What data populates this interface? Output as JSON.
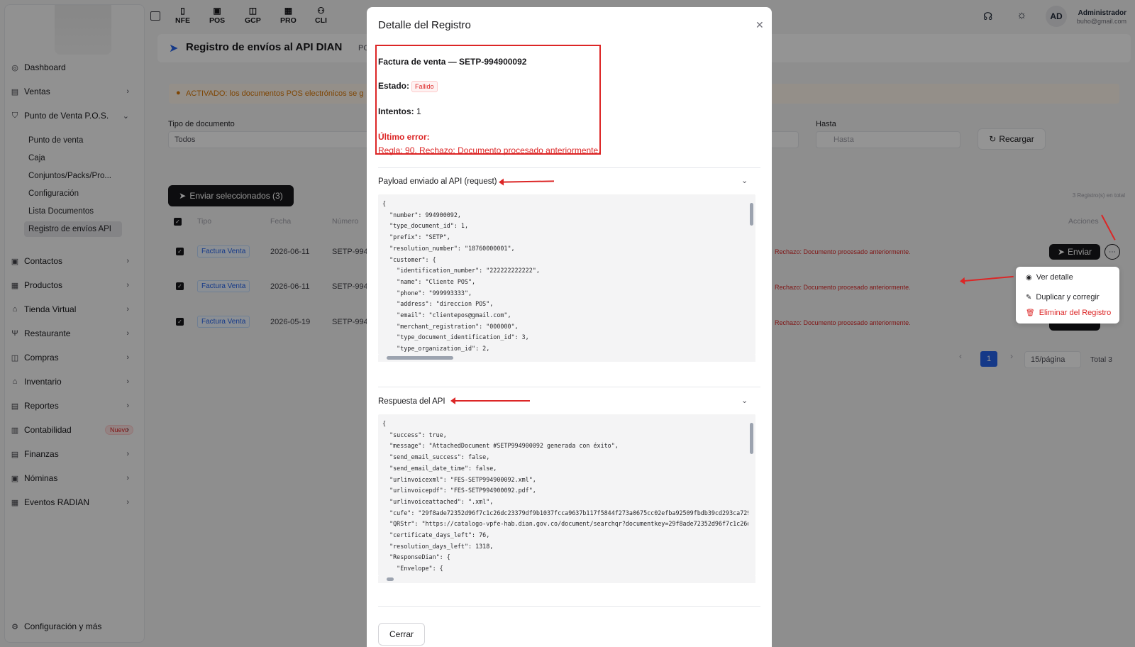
{
  "topbar": {
    "buttons": [
      {
        "label": "NFE",
        "icon": "file-icon"
      },
      {
        "label": "POS",
        "icon": "pos-icon"
      },
      {
        "label": "GCP",
        "icon": "bag-icon"
      },
      {
        "label": "PRO",
        "icon": "grid-icon"
      },
      {
        "label": "CLI",
        "icon": "users-icon"
      }
    ],
    "avatar_initials": "AD",
    "user_name": "Administrador",
    "user_email": "buho@gmail.com"
  },
  "sidebar": {
    "items": [
      {
        "label": "Dashboard",
        "icon": "dashboard-icon"
      },
      {
        "label": "Ventas",
        "icon": "receipt-icon"
      },
      {
        "label": "Punto de Venta P.O.S.",
        "icon": "cart-icon"
      },
      {
        "label": "Contactos",
        "icon": "contacts-icon"
      },
      {
        "label": "Productos",
        "icon": "grid-icon"
      },
      {
        "label": "Tienda Virtual",
        "icon": "store-icon"
      },
      {
        "label": "Restaurante",
        "icon": "restaurant-icon"
      },
      {
        "label": "Compras",
        "icon": "bag-icon"
      },
      {
        "label": "Inventario",
        "icon": "warehouse-icon"
      },
      {
        "label": "Reportes",
        "icon": "report-icon"
      },
      {
        "label": "Contabilidad",
        "icon": "calculator-icon",
        "badge": "Nuevo"
      },
      {
        "label": "Finanzas",
        "icon": "finance-icon"
      },
      {
        "label": "Nóminas",
        "icon": "payroll-icon"
      },
      {
        "label": "Eventos RADIAN",
        "icon": "calendar-icon"
      }
    ],
    "pos_subitems": [
      "Punto de venta",
      "Caja",
      "Conjuntos/Packs/Pro...",
      "Configuración",
      "Lista Documentos",
      "Registro de envíos API"
    ],
    "footer": "Configuración y más"
  },
  "page": {
    "title": "Registro de envíos al API DIAN",
    "title_suffix": "PO",
    "alert": "ACTIVADO: los documentos POS electrónicos se g",
    "filter_doc_label": "Tipo de documento",
    "filter_doc_value": "Todos",
    "filter_hasta_label": "Hasta",
    "filter_hasta_placeholder": "Hasta",
    "reload_button": "Recargar",
    "send_selected_button": "Enviar seleccionados (3)",
    "total_records": "3 Registro(s) en total",
    "columns": {
      "tipo": "Tipo",
      "fecha": "Fecha",
      "numero": "Número",
      "acciones": "Acciones"
    },
    "rows": [
      {
        "tipo": "Factura Venta",
        "fecha": "2026-06-11",
        "numero": "SETP-994",
        "error": "Rechazo: Documento procesado anteriormente."
      },
      {
        "tipo": "Factura Venta",
        "fecha": "2026-06-11",
        "numero": "SETP-994",
        "error": "Rechazo: Documento procesado anteriormente."
      },
      {
        "tipo": "Factura Venta",
        "fecha": "2026-05-19",
        "numero": "SETP-994",
        "error": "Rechazo: Documento procesado anteriormente."
      }
    ],
    "send_button": "Enviar",
    "pagination": {
      "current": "1",
      "per_page": "15/página",
      "total": "Total 3"
    }
  },
  "dropdown": {
    "view": "Ver detalle",
    "duplicate": "Duplicar y corregir",
    "delete": "Eliminar del Registro"
  },
  "modal": {
    "title": "Detalle del Registro",
    "doc_heading": "Factura de venta — SETP-994900092",
    "estado_label": "Estado:",
    "estado_value": "Fallido",
    "intentos_label": "Intentos:",
    "intentos_value": "1",
    "error_label": "Último error:",
    "error_text": "Regla: 90, Rechazo: Documento procesado anteriormente.",
    "payload_title": "Payload enviado al API (request)",
    "payload_code": "{\n  \"number\": 994900092,\n  \"type_document_id\": 1,\n  \"prefix\": \"SETP\",\n  \"resolution_number\": \"18760000001\",\n  \"customer\": {\n    \"identification_number\": \"222222222222\",\n    \"name\": \"Cliente POS\",\n    \"phone\": \"999993333\",\n    \"address\": \"direccion POS\",\n    \"email\": \"clientepos@gmail.com\",\n    \"merchant_registration\": \"000000\",\n    \"type_document_identification_id\": 3,\n    \"type_organization_id\": 2,",
    "response_title": "Respuesta del API",
    "response_code": "{\n  \"success\": true,\n  \"message\": \"AttachedDocument #SETP994900092 generada con éxito\",\n  \"send_email_success\": false,\n  \"send_email_date_time\": false,\n  \"urlinvoicexml\": \"FES-SETP994900092.xml\",\n  \"urlinvoicepdf\": \"FES-SETP994900092.pdf\",\n  \"urlinvoiceattached\": \".xml\",\n  \"cufe\": \"29f8ade72352d96f7c1c26dc23379df9b1037fcca9637b117f5844f273a0675cc02efba92509fbdb39cd293ca72913e\n  \"QRStr\": \"https://catalogo-vpfe-hab.dian.gov.co/document/searchqr?documentkey=29f8ade72352d96f7c1c26dc23\n  \"certificate_days_left\": 76,\n  \"resolution_days_left\": 1318,\n  \"ResponseDian\": {\n    \"Envelope\": {",
    "close_button": "Cerrar"
  },
  "colors": {
    "danger": "#dc2626",
    "primary_dark": "#18181b",
    "link_blue": "#2563eb"
  }
}
